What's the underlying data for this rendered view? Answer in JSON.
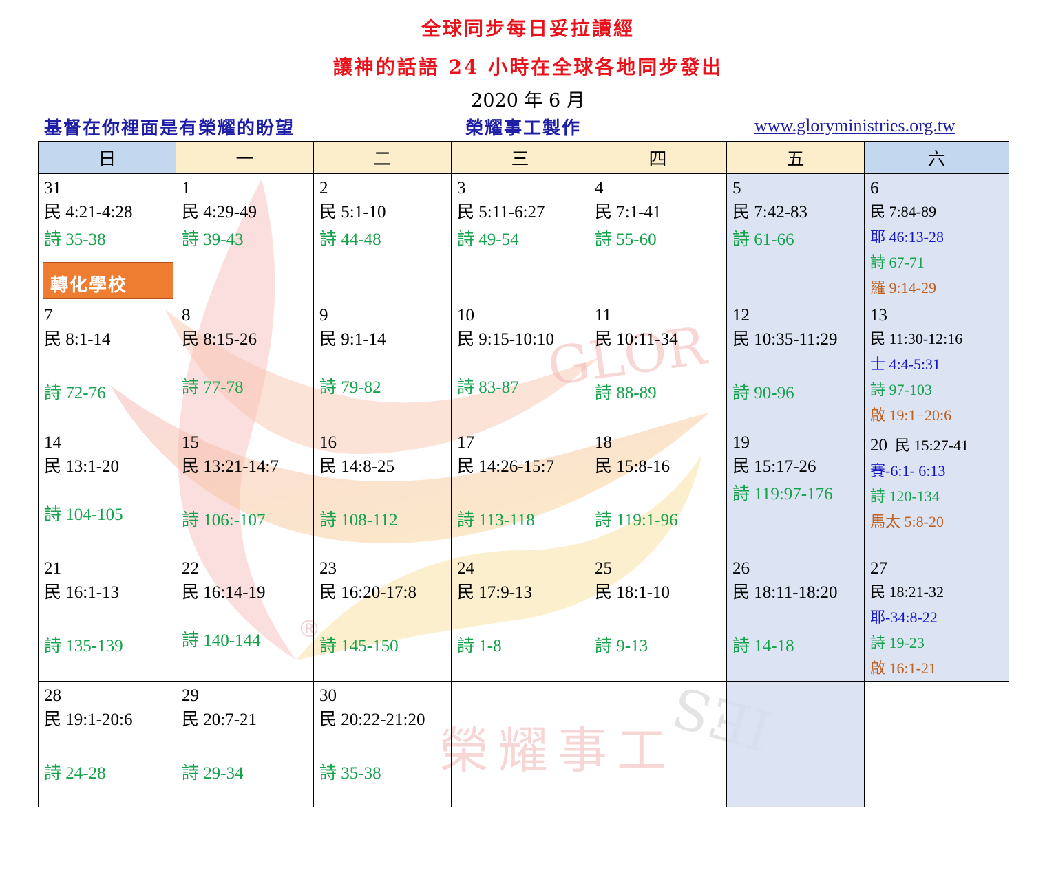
{
  "header": {
    "title": "全球同步每日妥拉讀經",
    "subtitle": "讓神的話語 24 小時在全球各地同步發出",
    "month": "2020 年 6 月",
    "motto": "基督在你裡面是有榮耀的盼望",
    "maker": "榮耀事工製作",
    "website": "www.gloryministries.org.tw"
  },
  "weekdays": [
    "日",
    "一",
    "二",
    "三",
    "四",
    "五",
    "六"
  ],
  "badge": "轉化學校",
  "watermark": {
    "text_cn": "榮耀事工",
    "text_glory": "GLOR",
    "text_ies": "IES",
    "reg": "®"
  },
  "colors": {
    "green": "#14a24a",
    "blue": "#1616c8",
    "brown": "#c0601f",
    "title_red": "#e8121b",
    "badge": "#ef7d31"
  },
  "weeks": [
    {
      "sun": {
        "date": "31",
        "lines": [
          "民 4:21-4:28",
          "詩 35-38"
        ]
      },
      "mon": {
        "date": "1",
        "lines": [
          "民 4:29-49",
          "詩 39-43"
        ]
      },
      "tue": {
        "date": "2",
        "lines": [
          "民 5:1-10",
          "詩 44-48"
        ]
      },
      "wed": {
        "date": "3",
        "lines": [
          "民 5:11-6:27",
          "詩 49-54"
        ]
      },
      "thu": {
        "date": "4",
        "lines": [
          "民 7:1-41",
          "詩 55-60"
        ]
      },
      "fri": {
        "date": "5",
        "lines": [
          "民 7:42-83",
          "詩 61-66"
        ]
      },
      "sat": {
        "date": "6",
        "lines": [
          "民 7:84-89",
          "耶 46:13-28",
          "詩 67-71",
          "羅 9:14-29"
        ]
      }
    },
    {
      "sun": {
        "date": "7",
        "lines": [
          "民 8:1-14",
          "詩 72-76"
        ]
      },
      "mon": {
        "date": "8",
        "lines": [
          "民 8:15-26",
          "詩 77-78"
        ]
      },
      "tue": {
        "date": "9",
        "lines": [
          "民 9:1-14",
          "詩 79-82"
        ]
      },
      "wed": {
        "date": "10",
        "lines": [
          "民 9:15-10:10",
          "詩 83-87"
        ]
      },
      "thu": {
        "date": "11",
        "lines": [
          "民 10:11-34",
          "詩 88-89"
        ]
      },
      "fri": {
        "date": "12",
        "lines": [
          "民 10:35-11:29",
          "詩 90-96"
        ]
      },
      "sat": {
        "date": "13",
        "lines": [
          "民 11:30-12:16",
          "士 4:4-5:31",
          "詩 97-103",
          "啟 19:1−20:6"
        ]
      }
    },
    {
      "sun": {
        "date": "14",
        "lines": [
          "民 13:1-20",
          "詩 104-105"
        ]
      },
      "mon": {
        "date": "15",
        "lines": [
          "民 13:21-14:7",
          "詩 106:-107"
        ]
      },
      "tue": {
        "date": "16",
        "lines": [
          "民 14:8-25",
          "詩 108-112"
        ]
      },
      "wed": {
        "date": "17",
        "lines": [
          "民 14:26-15:7",
          "詩 113-118"
        ]
      },
      "thu": {
        "date": "18",
        "lines": [
          "民 15:8-16",
          "詩 119:1-96"
        ]
      },
      "fri": {
        "date": "19",
        "lines": [
          "民 15:17-26",
          "詩 119:97-176"
        ]
      },
      "sat": {
        "date": "20",
        "lines": [
          "民 15:27-41",
          "賽-6:1- 6:13",
          "詩 120-134",
          "馬太 5:8-20"
        ]
      }
    },
    {
      "sun": {
        "date": "21",
        "lines": [
          "民 16:1-13",
          "詩 135-139"
        ]
      },
      "mon": {
        "date": "22",
        "lines": [
          "民 16:14-19",
          "詩 140-144"
        ]
      },
      "tue": {
        "date": "23",
        "lines": [
          "民 16:20-17:8",
          "詩 145-150"
        ]
      },
      "wed": {
        "date": "24",
        "lines": [
          "民 17:9-13",
          "詩 1-8"
        ]
      },
      "thu": {
        "date": "25",
        "lines": [
          "民 18:1-10",
          "詩 9-13"
        ]
      },
      "fri": {
        "date": "26",
        "lines": [
          "民 18:11-18:20",
          "詩 14-18"
        ]
      },
      "sat": {
        "date": "27",
        "lines": [
          "民 18:21-32",
          "耶-34:8-22",
          "詩 19-23",
          "啟 16:1-21"
        ]
      }
    },
    {
      "sun": {
        "date": "28",
        "lines": [
          "民 19:1-20:6",
          "詩 24-28"
        ]
      },
      "mon": {
        "date": "29",
        "lines": [
          "民 20:7-21",
          "詩 29-34"
        ]
      },
      "tue": {
        "date": "30",
        "lines": [
          "民 20:22-21:20",
          "詩 35-38"
        ]
      }
    }
  ]
}
